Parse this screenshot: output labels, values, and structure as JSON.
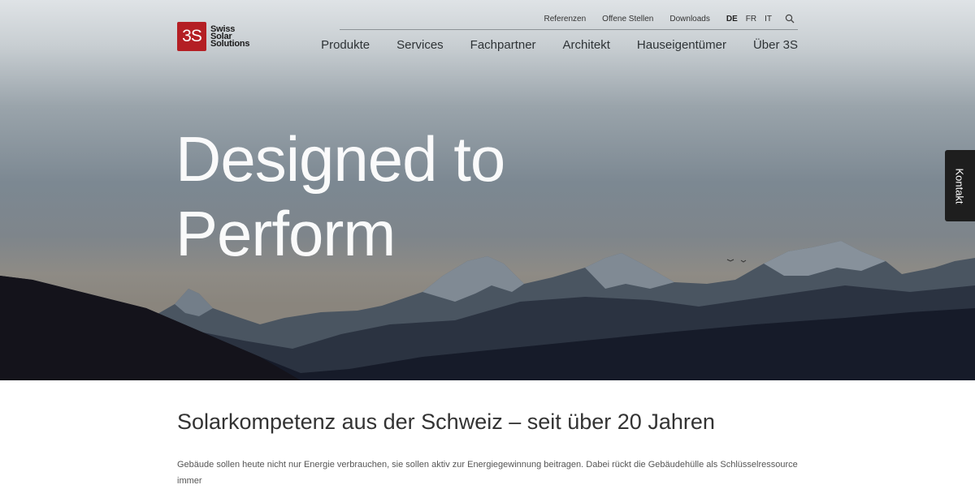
{
  "brand": {
    "mark": "3S",
    "name_lines": [
      "Swiss",
      "Solar",
      "Solutions"
    ],
    "mark_color": "#b41f24"
  },
  "top_nav": {
    "links": [
      "Referenzen",
      "Offene Stellen",
      "Downloads"
    ],
    "languages": [
      "DE",
      "FR",
      "IT"
    ],
    "active_language": "DE",
    "search_icon": "search-icon"
  },
  "main_nav": {
    "items": [
      "Produkte",
      "Services",
      "Fachpartner",
      "Architekt",
      "Hauseigentümer",
      "Über 3S"
    ]
  },
  "hero": {
    "headline_line1": "Designed to",
    "headline_line2": "Perform"
  },
  "contact_tab": {
    "label": "Kontakt"
  },
  "intro": {
    "title": "Solarkompetenz aus der Schweiz – seit über 20 Jahren",
    "text": "Gebäude sollen heute nicht nur Energie verbrauchen, sie sollen aktiv zur Energiegewinnung beitragen. Dabei rückt die Gebäudehülle als Schlüsselressource immer"
  }
}
